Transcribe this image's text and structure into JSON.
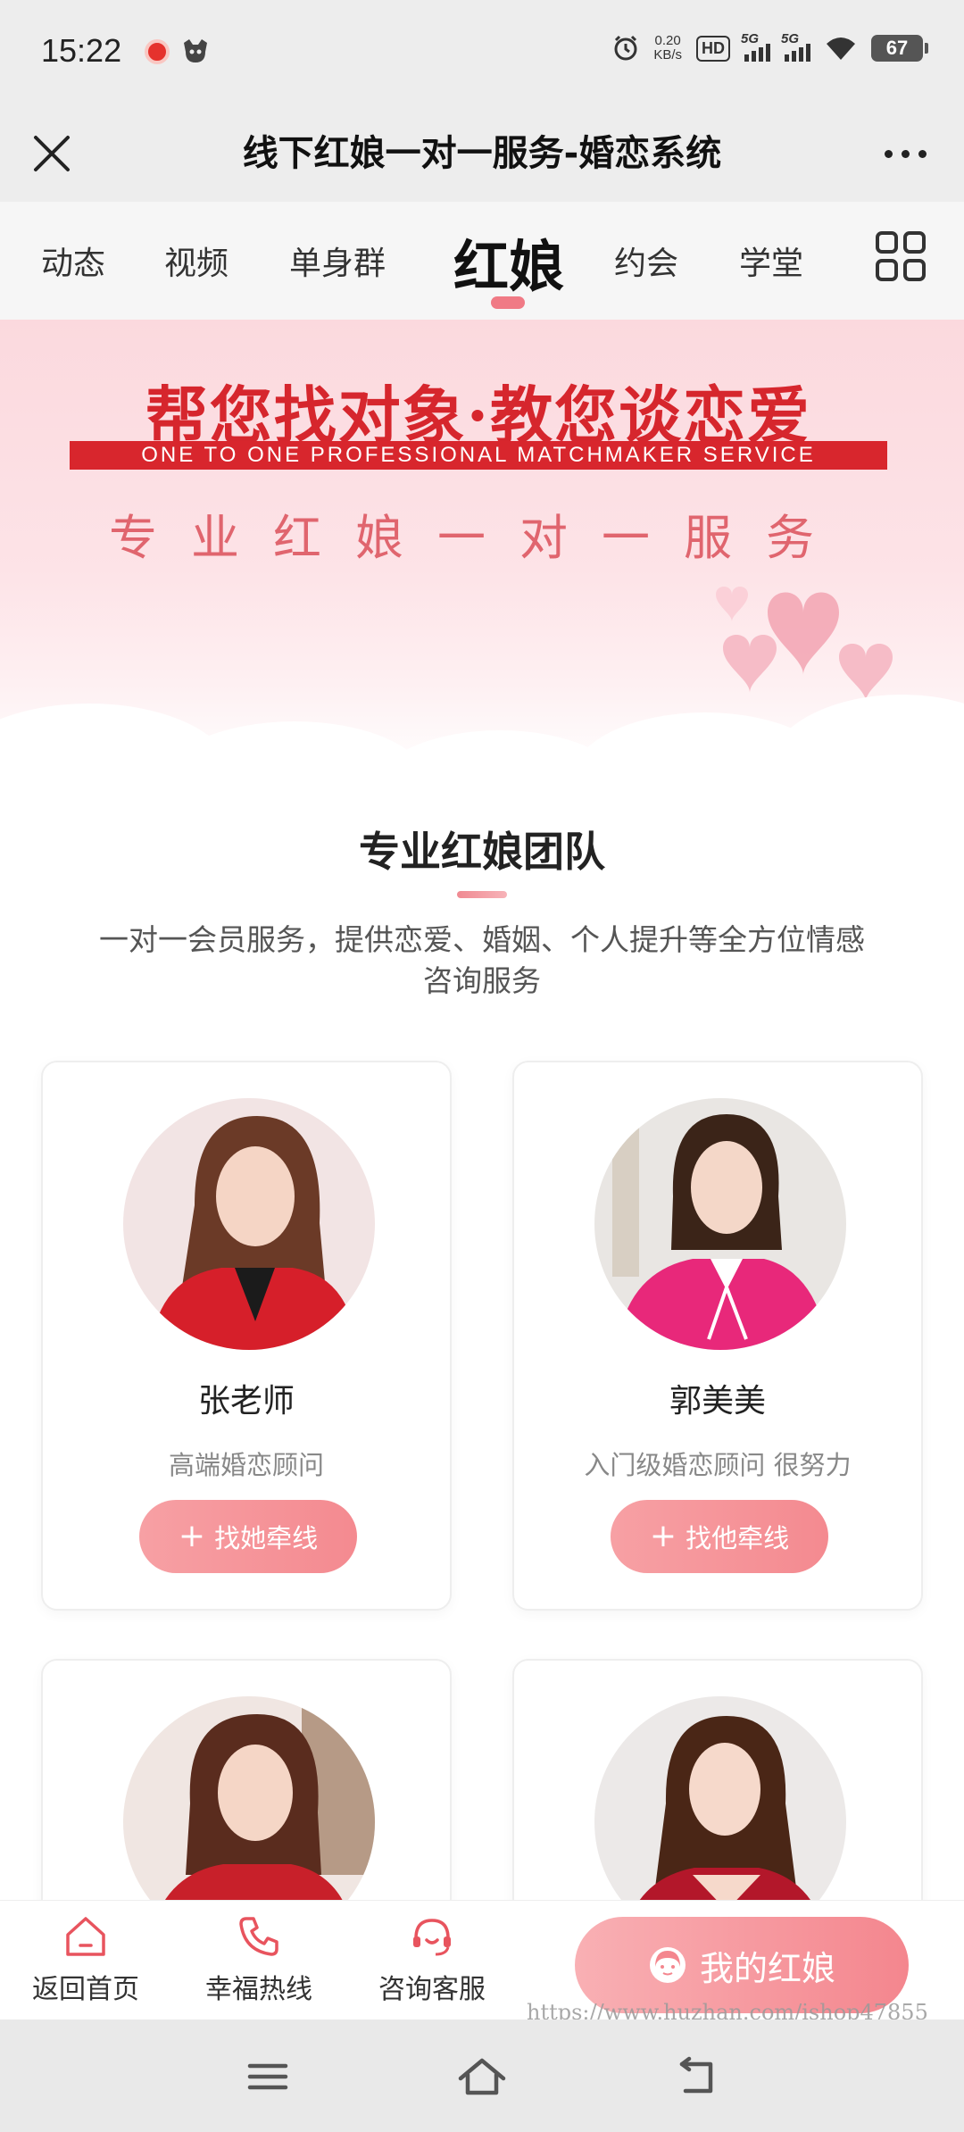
{
  "status_bar": {
    "time": "15:22",
    "speed_value": "0.20",
    "speed_unit": "KB/s",
    "hd_label": "HD",
    "sim1_label": "5G",
    "sim2_label": "5G",
    "battery": "67"
  },
  "header": {
    "title": "线下红娘一对一服务-婚恋系统"
  },
  "tabs": [
    {
      "label": "动态"
    },
    {
      "label": "视频"
    },
    {
      "label": "单身群"
    },
    {
      "label": "红娘"
    },
    {
      "label": "约会"
    },
    {
      "label": "学堂"
    }
  ],
  "active_tab": "红娘",
  "banner": {
    "headline": "帮您找对象·教您谈恋爱",
    "strip": "ONE TO ONE PROFESSIONAL MATCHMAKER SERVICE",
    "subtitle": "专业红娘一对一服务"
  },
  "section": {
    "title": "专业红娘团队",
    "description": "一对一会员服务，提供恋爱、婚姻、个人提升等全方位情感咨询服务"
  },
  "matchmakers": [
    {
      "name": "张老师",
      "role": "高端婚恋顾问",
      "button": "找她牵线"
    },
    {
      "name": "郭美美",
      "role": "入门级婚恋顾问 很努力",
      "button": "找他牵线"
    },
    {
      "name": "",
      "role": "",
      "button": ""
    },
    {
      "name": "",
      "role": "",
      "button": ""
    }
  ],
  "bottom_nav": {
    "home": "返回首页",
    "hotline": "幸福热线",
    "service": "咨询客服",
    "my_matchmaker": "我的红娘"
  },
  "watermark": "https://www.huzhan.com/ishop47855",
  "colors": {
    "accent": "#f48a90",
    "banner_red": "#d6262d",
    "banner_pink": "#fbd9de"
  }
}
